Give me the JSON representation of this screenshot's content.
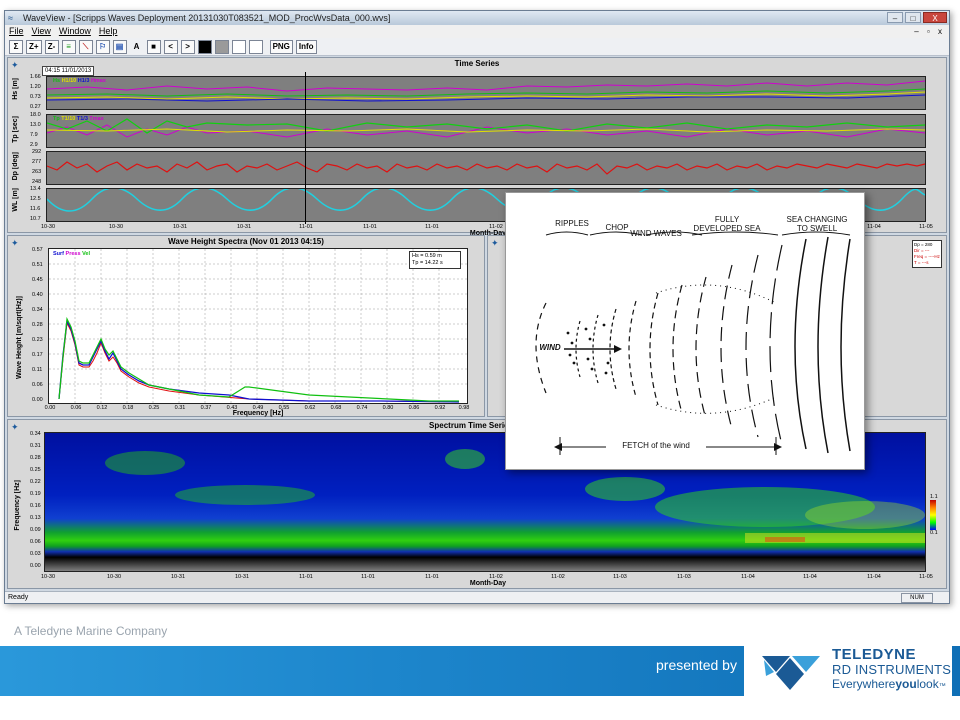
{
  "window": {
    "title": "WaveView - [Scripps Waves Deployment 20131030T083521_MOD_ProcWvsData_000.wvs]",
    "min_label": "–",
    "max_label": "□",
    "close_label": "X"
  },
  "menu": {
    "items": [
      "File",
      "View",
      "Window",
      "Help"
    ],
    "mdi_controls": "– ▫ x"
  },
  "toolbar": {
    "buttons": [
      "Σ",
      "Z+",
      "Z-",
      "≡",
      "⟍",
      "⚐",
      "▤",
      "A",
      "■",
      "<",
      ">",
      "",
      "",
      "",
      "",
      "PNG",
      "Info"
    ]
  },
  "time_series": {
    "title": "Time Series",
    "cursor_label": "04:15  11/01/2013",
    "xlabel": "Month-Day",
    "x_ticks": [
      "10-30",
      "10-30",
      "10-31",
      "10-31",
      "11-01",
      "11-01",
      "11-01",
      "11-02",
      "11-03",
      "11-03",
      "11-04",
      "11-04",
      "11-04",
      "11-05"
    ],
    "rows": [
      {
        "ylabel": "Hs [m]",
        "ticks": [
          "1.66",
          "1.20",
          "0.73",
          "0.27"
        ],
        "legend": [
          "Hs",
          "H1/10",
          "H1/3",
          "Hmax"
        ]
      },
      {
        "ylabel": "Tp [sec]",
        "ticks": [
          "18.0",
          "13.0",
          "7.9",
          "2.9"
        ],
        "legend": [
          "Tp",
          "T1/10",
          "T1/3",
          "Tmax"
        ]
      },
      {
        "ylabel": "Dp [deg]",
        "ticks": [
          "292",
          "277",
          "263",
          "248"
        ],
        "legend": []
      },
      {
        "ylabel": "WL [m]",
        "ticks": [
          "13.4",
          "12.5",
          "11.6",
          "10.7"
        ],
        "legend": []
      }
    ]
  },
  "spectra": {
    "title": "Wave Height Spectra (Nov 01 2013  04:15)",
    "ylabel": "Wave Height [m/sqrt(Hz)]",
    "xlabel": "Frequency [Hz]",
    "legend": [
      "Surf",
      "Press",
      "Vel"
    ],
    "stats": [
      "Hs = 0.59 m",
      "Tp = 14.22 s"
    ],
    "y_ticks": [
      "0.57",
      "0.51",
      "0.45",
      "0.40",
      "0.34",
      "0.28",
      "0.23",
      "0.17",
      "0.11",
      "0.06",
      "0.00"
    ],
    "x_ticks": [
      "0.00",
      "0.06",
      "0.12",
      "0.18",
      "0.25",
      "0.31",
      "0.37",
      "0.43",
      "0.49",
      "0.55",
      "0.62",
      "0.68",
      "0.74",
      "0.80",
      "0.86",
      "0.92",
      "0.98"
    ]
  },
  "direction_panel": {
    "stats": [
      "Dp = 280",
      "Dir = ---",
      "Freq = ----Hz",
      "T = ---s"
    ]
  },
  "spectrum_ts": {
    "title": "Spectrum Time Series [m",
    "ylabel": "Frequency [Hz]",
    "xlabel": "Month-Day",
    "y_ticks": [
      "0.34",
      "0.31",
      "0.28",
      "0.25",
      "0.22",
      "0.19",
      "0.16",
      "0.13",
      "0.09",
      "0.06",
      "0.03",
      "0.00"
    ],
    "x_ticks": [
      "10-30",
      "10-30",
      "10-31",
      "10-31",
      "11-01",
      "11-01",
      "11-01",
      "11-02",
      "11-02",
      "11-03",
      "11-03",
      "11-04",
      "11-04",
      "11-04",
      "11-05"
    ],
    "colorbar_ticks": [
      "1.1",
      "0.1"
    ]
  },
  "statusbar": {
    "text": "Ready",
    "num": "NUM"
  },
  "overlay": {
    "labels": {
      "ripples": "RIPPLES",
      "chop": "CHOP",
      "wind_waves": "WIND WAVES",
      "fully_developed": "FULLY DEVELOPED SEA",
      "sea_changing": "SEA CHANGING TO SWELL",
      "wind": "WIND",
      "fetch": "FETCH of the wind"
    }
  },
  "footer": {
    "company": "A Teledyne Marine Company",
    "presented_by": "presented by",
    "brand_name": "TELEDYNE",
    "brand_sub": "RD INSTRUMENTS",
    "tag_1": "Everywhere",
    "tag_2": "you",
    "tag_3": "look",
    "tm": "™"
  },
  "colors": {
    "accent_blue": "#1b8ad0",
    "brand_blue": "#1b5a95",
    "series_green": "#00dd00",
    "series_red": "#e01010",
    "series_magenta": "#d000d0",
    "series_cyan": "#20d0e0",
    "series_blue": "#1010d0"
  }
}
